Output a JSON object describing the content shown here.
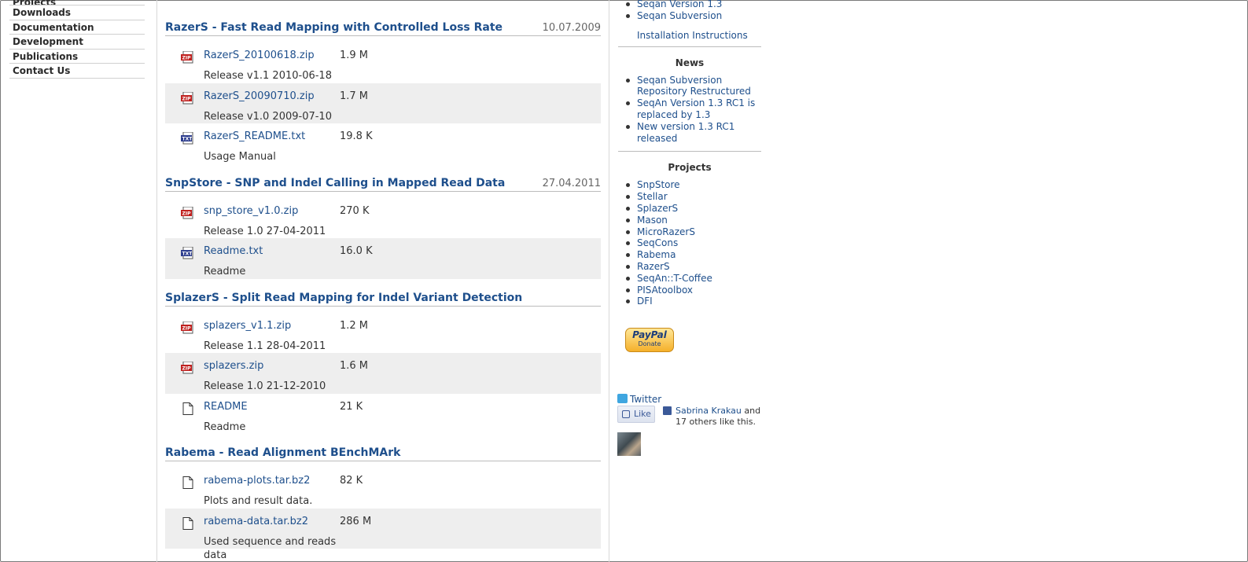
{
  "nav": {
    "items": [
      {
        "label": "Projects",
        "cut": true
      },
      {
        "label": "Downloads"
      },
      {
        "label": "Documentation"
      },
      {
        "label": "Development"
      },
      {
        "label": "Publications"
      },
      {
        "label": "Contact Us"
      }
    ]
  },
  "main": {
    "sections": [
      {
        "title": "RazerS - Fast Read Mapping with Controlled Loss Rate",
        "date": "10.07.2009",
        "files": [
          {
            "name": "RazerS_20100618.zip",
            "size": "1.9 M",
            "desc": "Release v1.1 2010-06-18",
            "type": "zip"
          },
          {
            "name": "RazerS_20090710.zip",
            "size": "1.7 M",
            "desc": "Release v1.0 2009-07-10",
            "type": "zip"
          },
          {
            "name": "RazerS_README.txt",
            "size": "19.8 K",
            "desc": "Usage Manual",
            "type": "txt"
          }
        ]
      },
      {
        "title": "SnpStore - SNP and Indel Calling in Mapped Read Data",
        "date": "27.04.2011",
        "files": [
          {
            "name": "snp_store_v1.0.zip",
            "size": "270 K",
            "desc": "Release 1.0 27-04-2011",
            "type": "zip"
          },
          {
            "name": "Readme.txt",
            "size": "16.0 K",
            "desc": "Readme",
            "type": "txt"
          }
        ]
      },
      {
        "title": "SplazerS - Split Read Mapping for Indel Variant Detection",
        "date": "",
        "files": [
          {
            "name": "splazers_v1.1.zip",
            "size": "1.2 M",
            "desc": "Release 1.1 28-04-2011",
            "type": "zip"
          },
          {
            "name": "splazers.zip",
            "size": "1.6 M",
            "desc": "Release 1.0 21-12-2010",
            "type": "zip"
          },
          {
            "name": "README",
            "size": "21 K",
            "desc": "Readme",
            "type": "doc"
          }
        ]
      },
      {
        "title": "Rabema - Read Alignment BEnchMArk",
        "date": "",
        "files": [
          {
            "name": "rabema-plots.tar.bz2",
            "size": "82 K",
            "desc": "Plots and result data.",
            "type": "doc"
          },
          {
            "name": "rabema-data.tar.bz2",
            "size": "286 M",
            "desc": "Used sequence and reads data",
            "type": "doc"
          }
        ]
      }
    ]
  },
  "sidebar": {
    "downloads": [
      "Seqan Version 1.3",
      "Seqan Subversion"
    ],
    "install_link": "Installation Instructions",
    "news_title": "News",
    "news": [
      "Seqan Subversion Repository Restructured",
      "SeqAn Version 1.3 RC1 is replaced by 1.3",
      "New version 1.3 RC1 released"
    ],
    "projects_title": "Projects",
    "projects": [
      "SnpStore",
      "Stellar",
      "SplazerS",
      "Mason",
      "MicroRazerS",
      "SeqCons",
      "Rabema",
      "RazerS",
      "SeqAn::T-Coffee",
      "PISAtoolbox",
      "DFI"
    ],
    "paypal": {
      "brand": "PayPal",
      "label": "Donate"
    },
    "twitter": "Twitter",
    "like_label": "Like",
    "fb_name": "Sabrina Krakau",
    "fb_and": "and",
    "fb_rest": "17 others like this."
  },
  "colors": {
    "link": "#1e4f8c",
    "alt_row": "#eeeeee"
  }
}
